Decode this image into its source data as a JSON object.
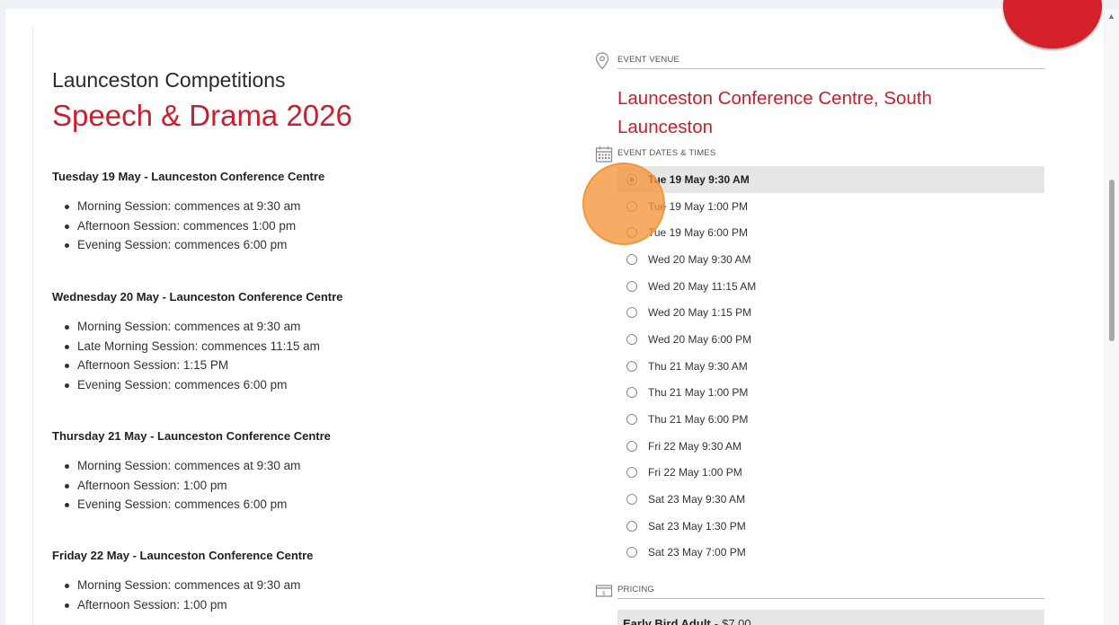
{
  "event": {
    "organizer": "Launceston Competitions",
    "title": "Speech & Drama 2026"
  },
  "schedule": [
    {
      "heading": "Tuesday 19 May - Launceston Conference Centre",
      "sessions": [
        "Morning Session: commences at 9:30 am",
        "Afternoon Session: commences 1:00 pm",
        "Evening Session: commences 6:00 pm"
      ]
    },
    {
      "heading": "Wednesday 20 May - Launceston Conference Centre",
      "sessions": [
        "Morning Session: commences at 9:30 am",
        "Late Morning Session: commences 11:15 am",
        "Afternoon Session: 1:15 PM",
        "Evening Session: commences 6:00 pm"
      ]
    },
    {
      "heading": "Thursday 21 May - Launceston Conference Centre",
      "sessions": [
        "Morning Session: commences at 9:30 am",
        "Afternoon Session: 1:00 pm",
        "Evening Session: commences 6:00 pm"
      ]
    },
    {
      "heading": "Friday 22 May - Launceston Conference Centre",
      "sessions": [
        "Morning Session: commences at 9:30 am",
        "Afternoon Session: 1:00 pm"
      ]
    }
  ],
  "venue": {
    "label": "EVENT VENUE",
    "name": "Launceston Conference Centre, South Launceston",
    "icon": "map-pin-icon"
  },
  "dates": {
    "label": "EVENT DATES & TIMES",
    "icon": "calendar-icon",
    "selected_index": 0,
    "options": [
      "Tue 19 May 9:30 AM",
      "Tue 19 May 1:00 PM",
      "Tue 19 May 6:00 PM",
      "Wed 20 May 9:30 AM",
      "Wed 20 May 11:15 AM",
      "Wed 20 May 1:15 PM",
      "Wed 20 May 6:00 PM",
      "Thu 21 May 9:30 AM",
      "Thu 21 May 1:00 PM",
      "Thu 21 May 6:00 PM",
      "Fri 22 May 9:30 AM",
      "Fri 22 May 1:00 PM",
      "Sat 23 May 9:30 AM",
      "Sat 23 May 1:30 PM",
      "Sat 23 May 7:00 PM"
    ]
  },
  "pricing": {
    "label": "PRICING",
    "icon": "price-tag-icon",
    "items": [
      {
        "name": "Early Bird Adult",
        "sep": "-",
        "price": "$7.00"
      }
    ]
  },
  "colors": {
    "brand_red": "#c8202f",
    "highlight_row": "#e6e6e6",
    "click_marker": "#f49538"
  }
}
